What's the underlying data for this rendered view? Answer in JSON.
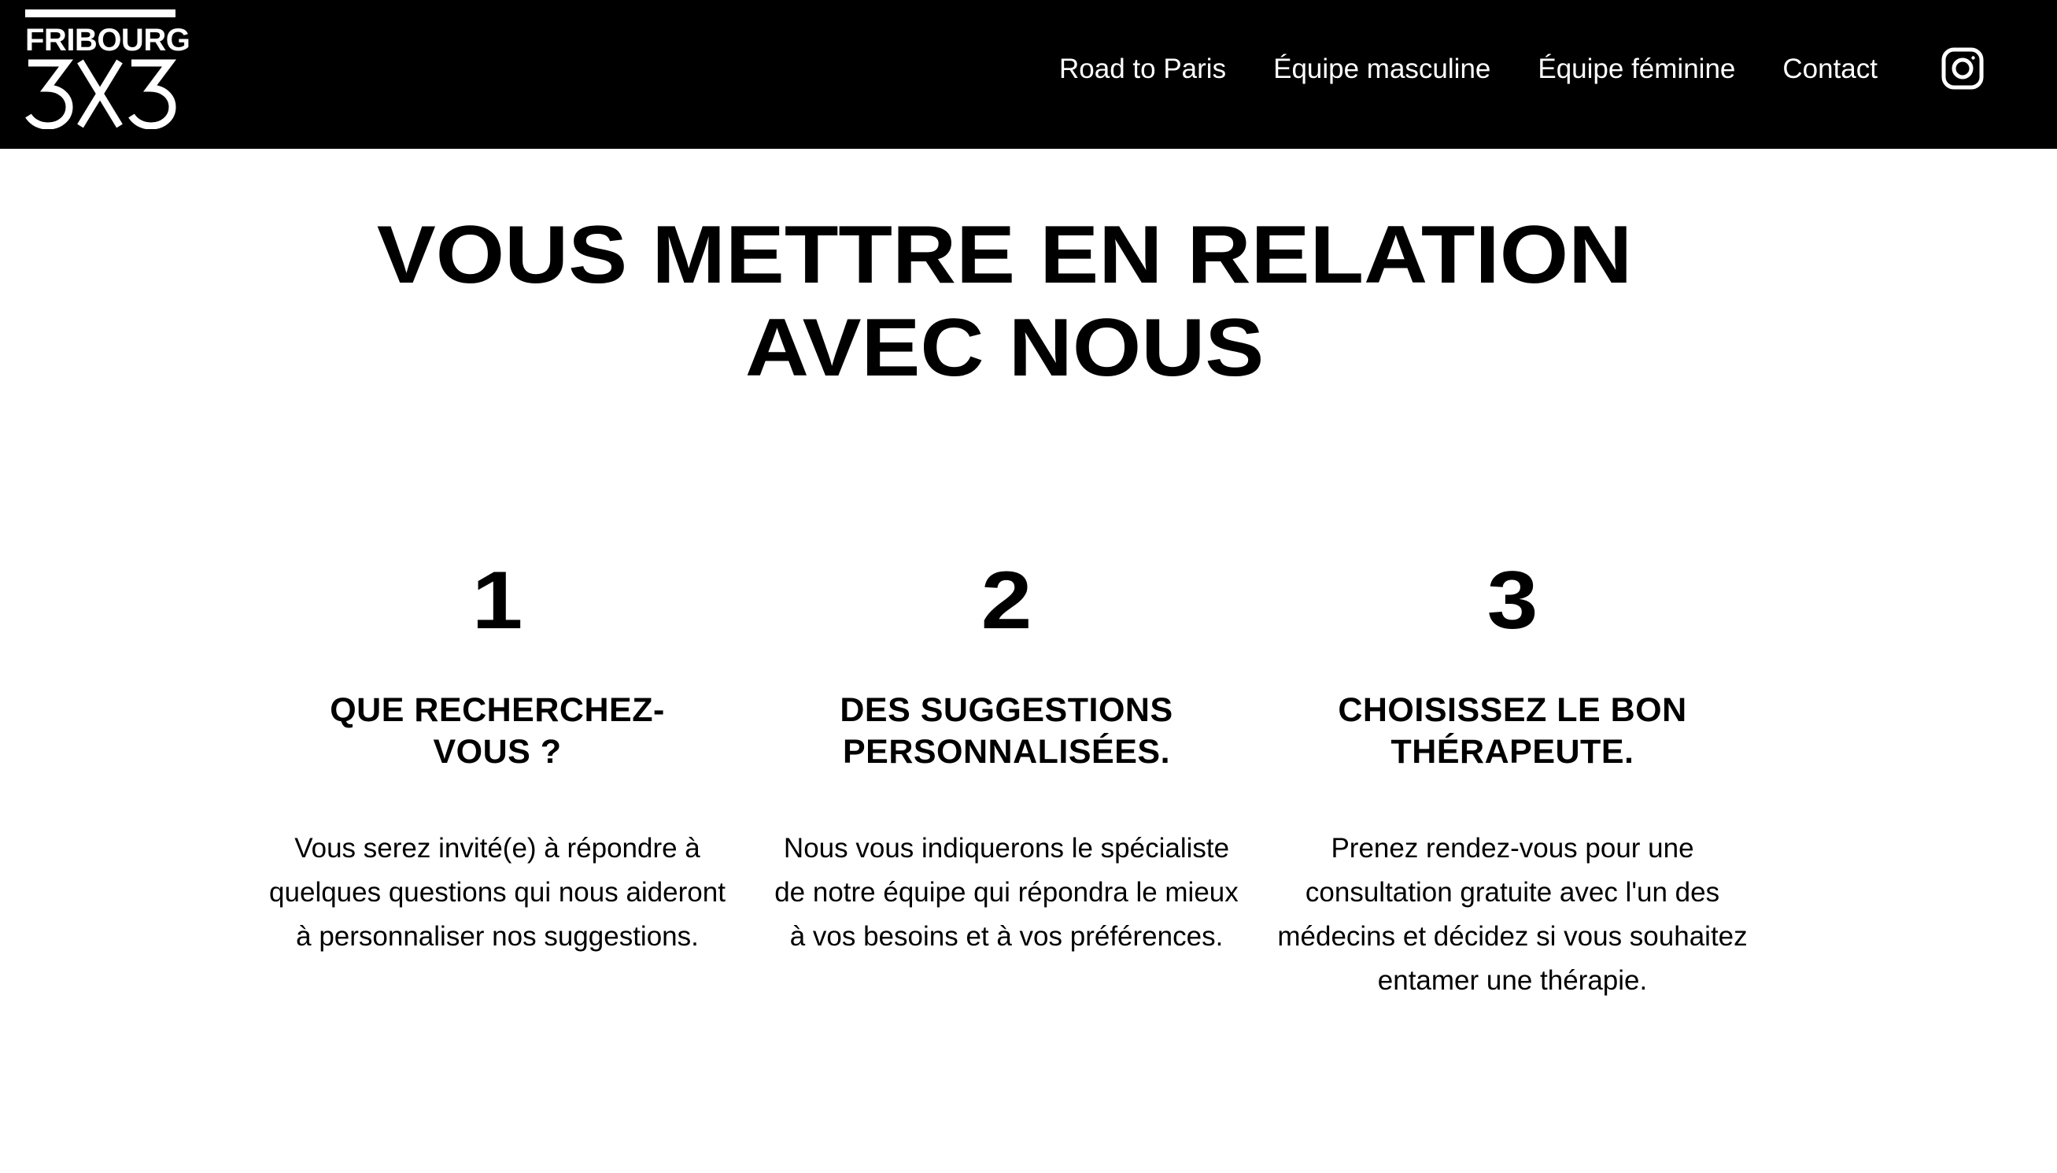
{
  "header": {
    "logo": {
      "wordmark": "FRIBOURG",
      "mark": "3X3"
    },
    "nav": [
      {
        "label": "Road to Paris"
      },
      {
        "label": "Équipe masculine"
      },
      {
        "label": "Équipe féminine"
      },
      {
        "label": "Contact"
      }
    ],
    "instagram_icon": "instagram-icon"
  },
  "main": {
    "title_line1": "VOUS METTRE EN RELATION",
    "title_line2": "AVEC NOUS",
    "steps": [
      {
        "number": "1",
        "heading": "QUE RECHERCHEZ-\nVOUS ?",
        "text": "Vous serez invité(e) à répondre à quelques questions qui nous aideront à personnaliser nos suggestions."
      },
      {
        "number": "2",
        "heading": "DES SUGGESTIONS\nPERSONNALISÉES.",
        "text": "Nous vous indiquerons le spécialiste de notre équipe qui répondra le mieux à vos besoins et à vos préférences."
      },
      {
        "number": "3",
        "heading": "CHOISISSEZ LE BON\nTHÉRAPEUTE.",
        "text": "Prenez rendez-vous pour une consultation gratuite avec l'un des médecins et décidez si vous souhaitez entamer une thérapie."
      }
    ]
  },
  "colors": {
    "header_bg": "#000000",
    "header_text": "#ffffff",
    "page_bg": "#ffffff",
    "body_text": "#000000"
  }
}
